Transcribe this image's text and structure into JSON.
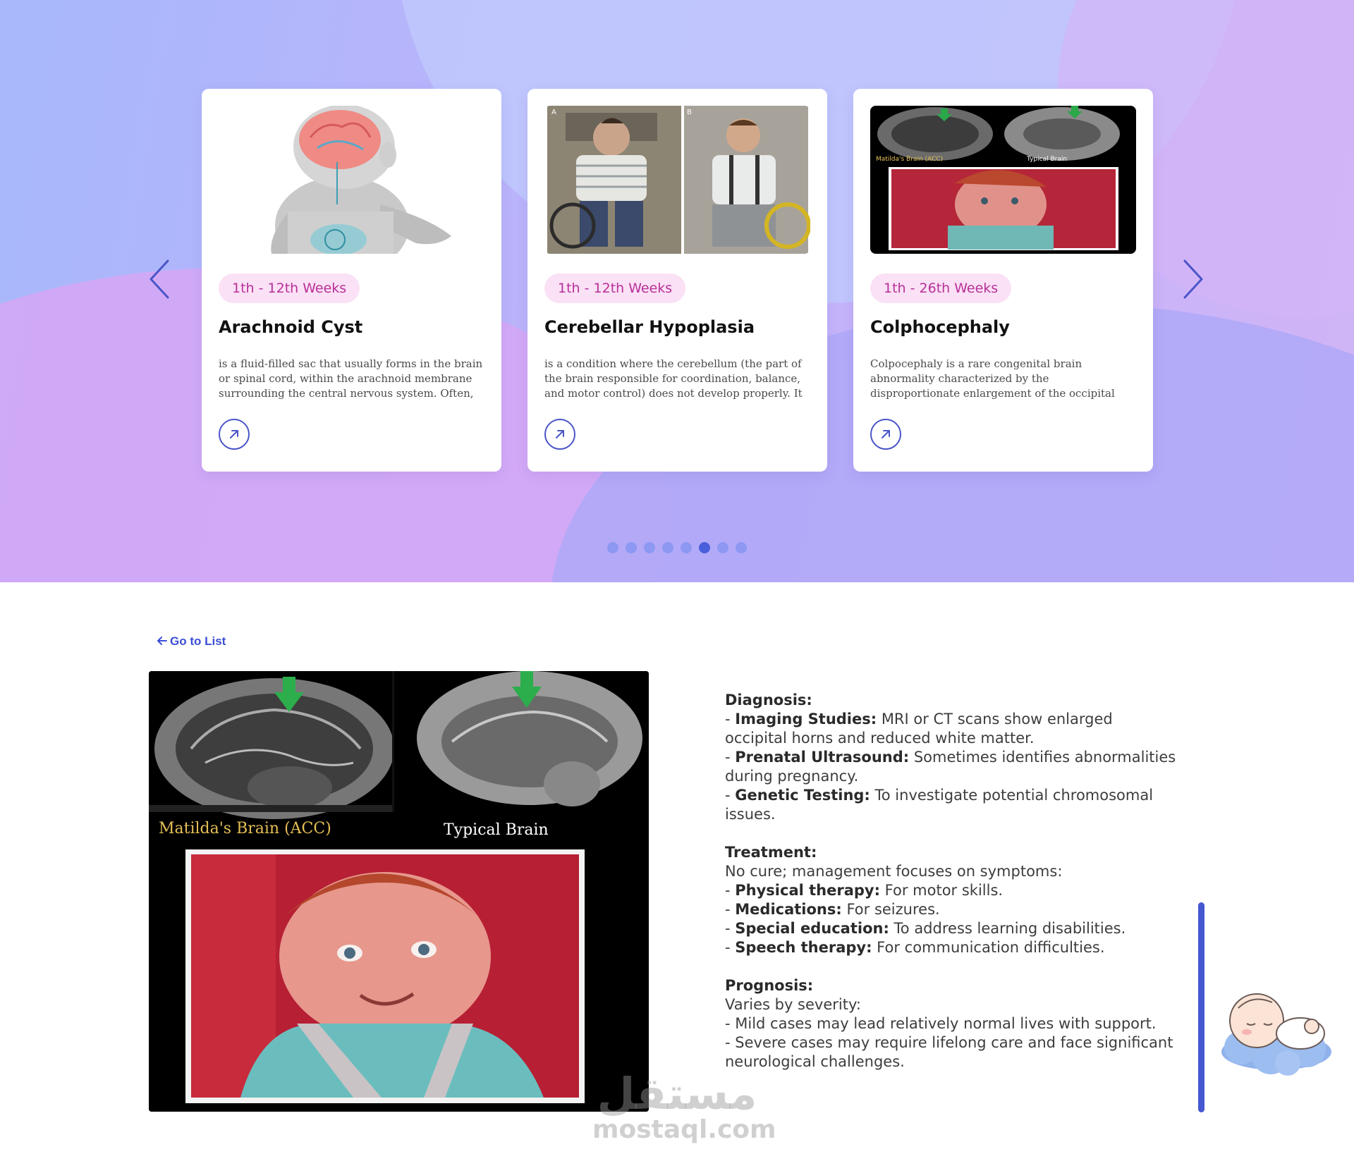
{
  "carousel": {
    "cards": [
      {
        "badge": "1th - 12th Weeks",
        "title": "Arachnoid Cyst",
        "description": "is a fluid-filled sac that usually forms in the brain or spinal cord, within the arachnoid membrane surrounding the central nervous system. Often, it ..."
      },
      {
        "badge": "1th - 12th Weeks",
        "title": "Cerebellar Hypoplasia",
        "description": "is a condition where the cerebellum (the part of the brain responsible for coordination, balance, and motor control) does not develop properly. It can ..."
      },
      {
        "badge": "1th - 26th Weeks",
        "title": "Colphocephaly",
        "description": "Colpocephaly is a rare congenital brain abnormality characterized by the disproportionate enlargement of the occipital horns of the brain's lateral..."
      }
    ],
    "dots": {
      "count": 8,
      "active_index": 5
    },
    "accent_color": "#4a55c8",
    "badge_color": "#b6309a"
  },
  "detail": {
    "back_link": "Go to List",
    "image_labels": {
      "left": "Matilda's Brain (ACC)",
      "right": "Typical Brain"
    },
    "diagnosis": {
      "heading": "Diagnosis:",
      "items": [
        {
          "term": "Imaging Studies:",
          "text": " MRI or CT scans show enlarged occipital horns and reduced white matter."
        },
        {
          "term": "Prenatal Ultrasound:",
          "text": " Sometimes identifies abnormalities during pregnancy."
        },
        {
          "term": "Genetic Testing:",
          "text": " To investigate potential chromosomal issues."
        }
      ]
    },
    "treatment": {
      "heading": "Treatment:",
      "intro": "No cure; management focuses on symptoms:",
      "items": [
        {
          "term": "Physical therapy:",
          "text": " For motor skills."
        },
        {
          "term": "Medications:",
          "text": " For seizures."
        },
        {
          "term": "Special education:",
          "text": " To address learning disabilities."
        },
        {
          "term": "Speech therapy:",
          "text": " For communication difficulties."
        }
      ]
    },
    "prognosis": {
      "heading": "Prognosis:",
      "intro": "Varies by severity:",
      "items": [
        "Mild cases may lead relatively normal lives with support.",
        "Severe cases may require lifelong care and face significant neurological challenges."
      ]
    }
  },
  "watermark": {
    "arabic": "مستقل",
    "latin": "mostaql.com"
  }
}
